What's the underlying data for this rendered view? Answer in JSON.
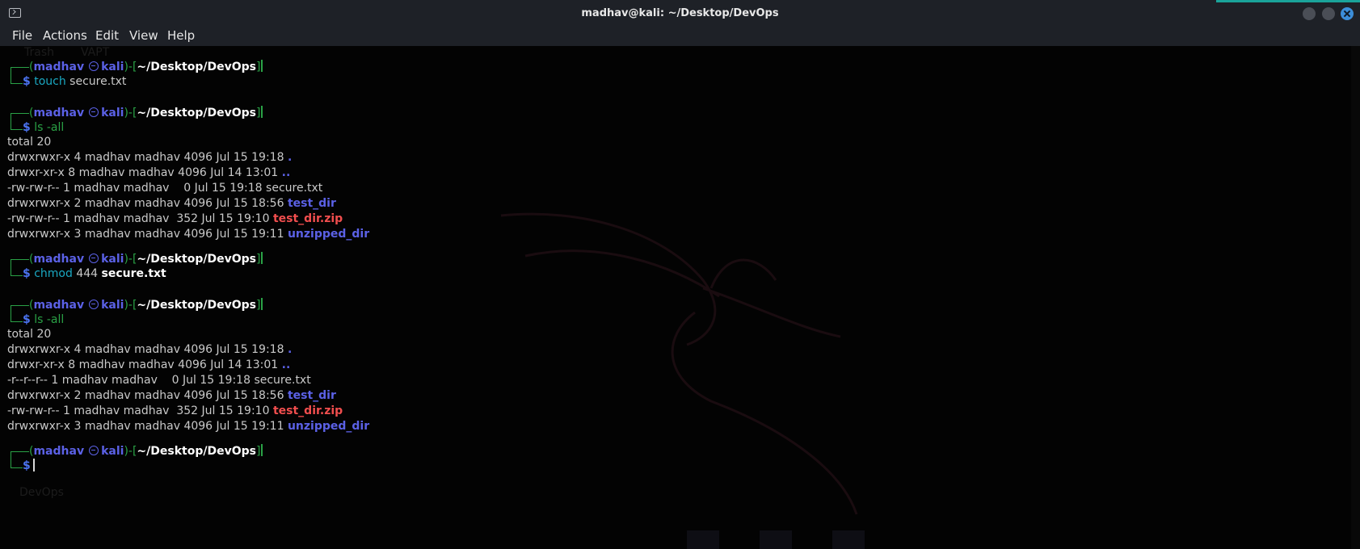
{
  "window": {
    "title": "madhav@kali: ~/Desktop/DevOps"
  },
  "menu": {
    "file": "File",
    "actions": "Actions",
    "edit": "Edit",
    "view": "View",
    "help": "Help"
  },
  "desktop": {
    "ghost_trash": "Trash",
    "ghost_vapt": "VAPT",
    "ghost_devops": "DevOps"
  },
  "prompt": {
    "open": "(",
    "user": "madhav",
    "host": "kali",
    "close": ")-[",
    "path": "~/Desktop/DevOps",
    "end": "]",
    "dollar": "$"
  },
  "commands": [
    {
      "cmd": "touch",
      "args": "secure.txt"
    },
    {
      "cmd": "ls -all",
      "args": ""
    },
    {
      "cmd": "chmod",
      "args": "444",
      "file": "secure.txt"
    },
    {
      "cmd": "ls -all",
      "args": ""
    }
  ],
  "listing1": {
    "total": "total 20",
    "rows": [
      {
        "meta": "drwxrwxr-x 4 madhav madhav 4096 Jul 15 19:18 ",
        "name": "."
      },
      {
        "meta": "drwxr-xr-x 8 madhav madhav 4096 Jul 14 13:01 ",
        "name": ".."
      },
      {
        "meta": "-rw-rw-r-- 1 madhav madhav    0 Jul 15 19:18 ",
        "name": "secure.txt"
      },
      {
        "meta": "drwxrwxr-x 2 madhav madhav 4096 Jul 15 18:56 ",
        "name": "test_dir"
      },
      {
        "meta": "-rw-rw-r-- 1 madhav madhav  352 Jul 15 19:10 ",
        "name": "test_dir.zip"
      },
      {
        "meta": "drwxrwxr-x 3 madhav madhav 4096 Jul 15 19:11 ",
        "name": "unzipped_dir"
      }
    ]
  },
  "listing2": {
    "total": "total 20",
    "rows": [
      {
        "meta": "drwxrwxr-x 4 madhav madhav 4096 Jul 15 19:18 ",
        "name": "."
      },
      {
        "meta": "drwxr-xr-x 8 madhav madhav 4096 Jul 14 13:01 ",
        "name": ".."
      },
      {
        "meta": "-r--r--r-- 1 madhav madhav    0 Jul 15 19:18 ",
        "name": "secure.txt"
      },
      {
        "meta": "drwxrwxr-x 2 madhav madhav 4096 Jul 15 18:56 ",
        "name": "test_dir"
      },
      {
        "meta": "-rw-rw-r-- 1 madhav madhav  352 Jul 15 19:10 ",
        "name": "test_dir.zip"
      },
      {
        "meta": "drwxrwxr-x 3 madhav madhav 4096 Jul 15 19:11 ",
        "name": "unzipped_dir"
      }
    ]
  },
  "colors": {
    "prompt_green": "#2aa246",
    "user_blue": "#5b61e6",
    "dir_blue": "#5b61e6",
    "zip_red": "#f14e4e",
    "command_cyan": "#1aa8c2",
    "close_button": "#3c8ed9"
  }
}
